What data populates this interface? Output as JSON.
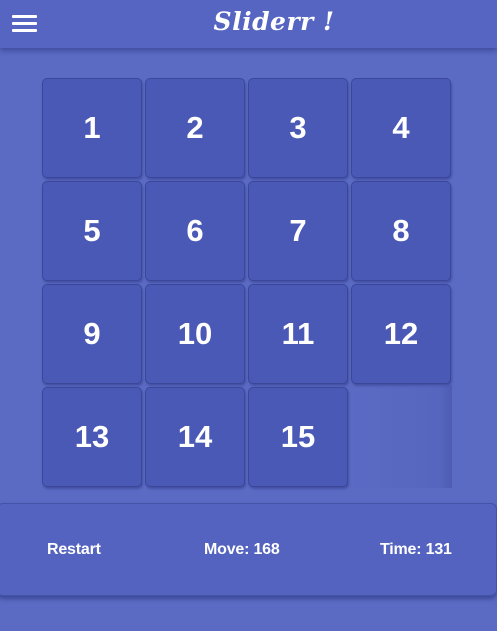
{
  "app_bar": {
    "title": "Sliderr !",
    "menu_icon": "hamburger-menu-icon"
  },
  "board": {
    "rows": 4,
    "cols": 4,
    "tiles": [
      "1",
      "2",
      "3",
      "4",
      "5",
      "6",
      "7",
      "8",
      "9",
      "10",
      "11",
      "12",
      "13",
      "14",
      "15",
      ""
    ]
  },
  "status": {
    "restart_label": "Restart",
    "move_label": "Move: 168",
    "time_label": "Time: 131"
  },
  "colors": {
    "background": "#5b6bc4",
    "app_bar": "#5565c1",
    "tile": "#4a59b6",
    "tile_border": "#3b4899",
    "text": "#ffffff"
  }
}
